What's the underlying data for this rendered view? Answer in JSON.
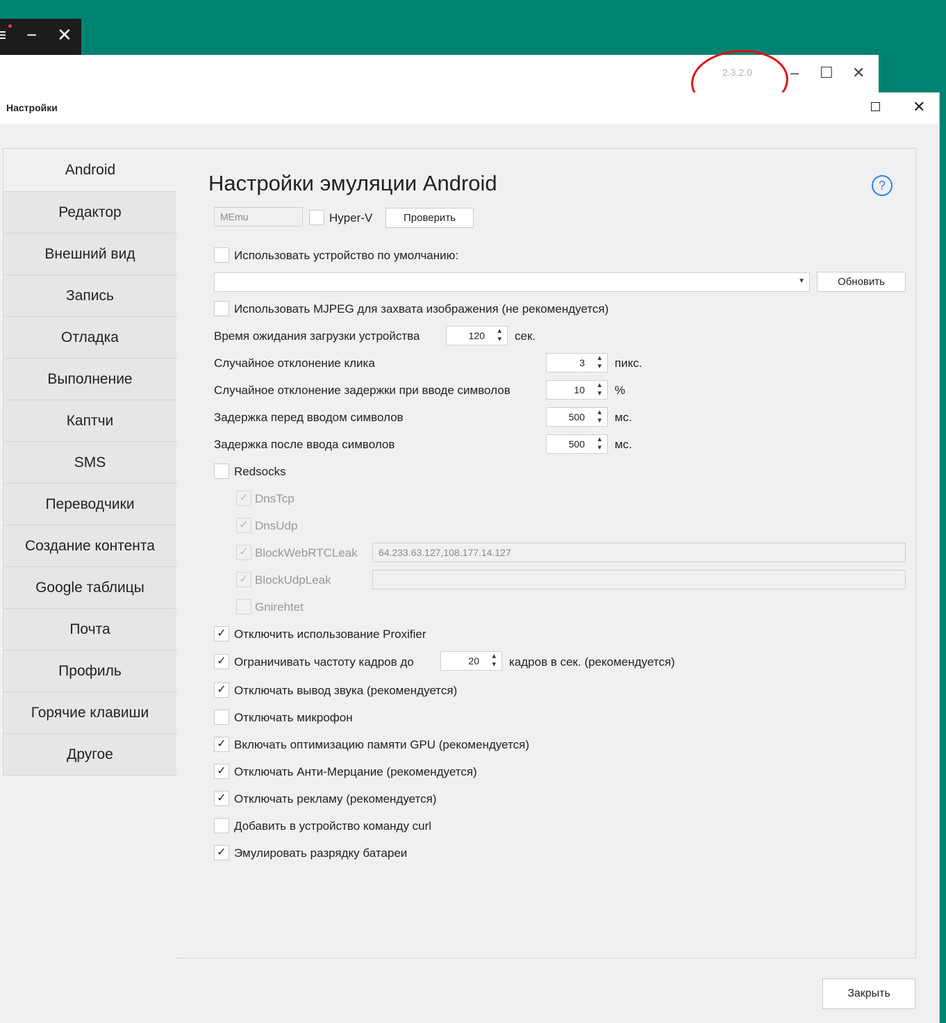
{
  "mini_window": {
    "menu_icon": "hamburger-icon",
    "min_icon": "minimize-icon",
    "close_icon": "close-icon"
  },
  "back_window": {
    "version": "2.3.2.0"
  },
  "dialog": {
    "title": "Настройки",
    "close_label": "Закрыть"
  },
  "sidebar": {
    "items": [
      {
        "label": "Android"
      },
      {
        "label": "Редактор"
      },
      {
        "label": "Внешний вид"
      },
      {
        "label": "Запись"
      },
      {
        "label": "Отладка"
      },
      {
        "label": "Выполнение"
      },
      {
        "label": "Каптчи"
      },
      {
        "label": "SMS"
      },
      {
        "label": "Переводчики"
      },
      {
        "label": "Создание контента"
      },
      {
        "label": "Google таблицы"
      },
      {
        "label": "Почта"
      },
      {
        "label": "Профиль"
      },
      {
        "label": "Горячие клавиши"
      },
      {
        "label": "Другое"
      }
    ]
  },
  "content": {
    "heading": "Настройки эмуляции Android",
    "help": "?",
    "emulator_value": "MEmu",
    "hyperv_label": "Hyper-V",
    "check_button": "Проверить",
    "use_default_device": "Использовать устройство по умолчанию:",
    "device_select_value": "",
    "refresh_button": "Обновить",
    "use_mjpeg": "Использовать MJPEG для захвата изображения (не рекомендуется)",
    "boot_wait_label": "Время ожидания загрузки устройства",
    "boot_wait_value": "120",
    "boot_wait_unit": "сек.",
    "click_dev_label": "Случайное отклонение клика",
    "click_dev_value": "3",
    "click_dev_unit": "пикс.",
    "typing_dev_label": "Случайное отклонение задержки при вводе символов",
    "typing_dev_value": "10",
    "typing_dev_unit": "%",
    "delay_before_label": "Задержка перед вводом символов",
    "delay_before_value": "500",
    "delay_before_unit": "мс.",
    "delay_after_label": "Задержка после ввода символов",
    "delay_after_value": "500",
    "delay_after_unit": "мс.",
    "redsocks": "Redsocks",
    "dnstcp": "DnsTcp",
    "dnsudp": "DnsUdp",
    "blockwebrtc": "BlockWebRTCLeak",
    "blockwebrtc_value": "64.233.63.127,108.177.14.127",
    "blockudp": "BlockUdpLeak",
    "blockudp_value": "",
    "gnirehtet": "Gnirehtet",
    "disable_proxifier": "Отключить использование Proxifier",
    "limit_fps": "Ограничивать частоту кадров до",
    "limit_fps_value": "20",
    "limit_fps_unit": "кадров в сек. (рекомендуется)",
    "mute_sound": "Отключать вывод звука (рекомендуется)",
    "mute_mic": "Отключать микрофон",
    "gpu_opt": "Включать оптимизацию памяти GPU (рекомендуется)",
    "anti_flicker": "Отключать Анти-Мерцание (рекомендуется)",
    "disable_ads": "Отключать рекламу (рекомендуется)",
    "add_curl": "Добавить в устройство команду curl",
    "emulate_battery": "Эмулировать разрядку батареи"
  },
  "check_mark": "✓",
  "spinner_glyph": "⌃\n⌄"
}
